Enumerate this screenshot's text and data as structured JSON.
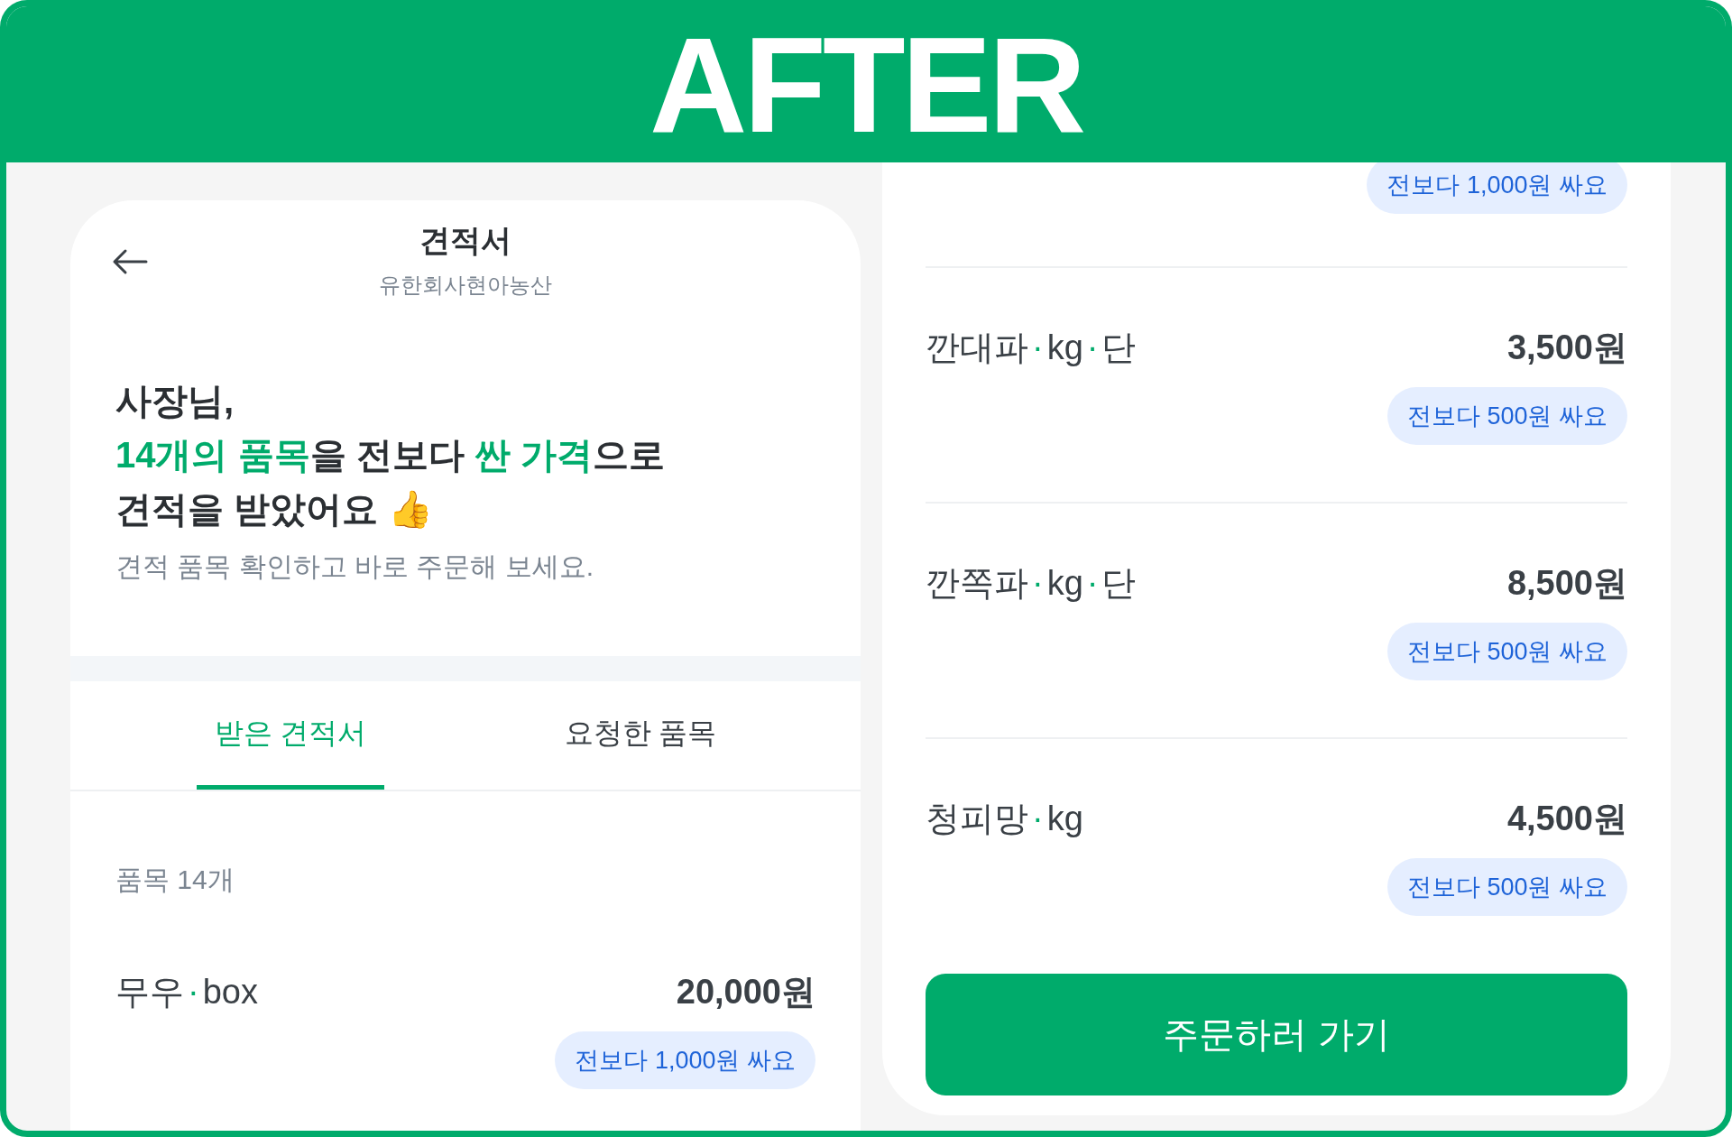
{
  "banner": {
    "text": "AFTER"
  },
  "left_screen": {
    "header": {
      "title": "견적서",
      "subtitle": "유한회사현아농산"
    },
    "headline": [
      [
        {
          "text": "사장님,",
          "highlight": false
        }
      ],
      [
        {
          "text": "14개의 품목",
          "highlight": true
        },
        {
          "text": "을 전보다 ",
          "highlight": false
        },
        {
          "text": "싼 가격",
          "highlight": true
        },
        {
          "text": "으로",
          "highlight": false
        }
      ],
      [
        {
          "text": "견적을 받았어요 👍",
          "highlight": false
        }
      ]
    ],
    "subtext": "견적 품목 확인하고 바로 주문해 보세요.",
    "tabs": [
      {
        "label": "받은 견적서",
        "selected": true
      },
      {
        "label": "요청한 품목",
        "selected": false
      }
    ],
    "count": "품목 14개",
    "items": [
      {
        "parts": [
          "무우",
          "·",
          "box"
        ],
        "price": "20,000원",
        "badge": "전보다 1,000원 싸요"
      }
    ]
  },
  "right_screen": {
    "items": [
      {
        "badge": "전보다 1,000원 싸요"
      },
      {
        "parts": [
          "깐대파",
          "·",
          "kg",
          "·",
          "단"
        ],
        "price": "3,500원",
        "badge": "전보다 500원 싸요"
      },
      {
        "parts": [
          "깐쪽파",
          "·",
          "kg",
          "·",
          "단"
        ],
        "price": "8,500원",
        "badge": "전보다 500원 싸요"
      },
      {
        "parts": [
          "청피망",
          "·",
          "kg"
        ],
        "price": "4,500원",
        "badge": "전보다 500원 싸요"
      }
    ],
    "order_button": "주문하러 가기"
  }
}
